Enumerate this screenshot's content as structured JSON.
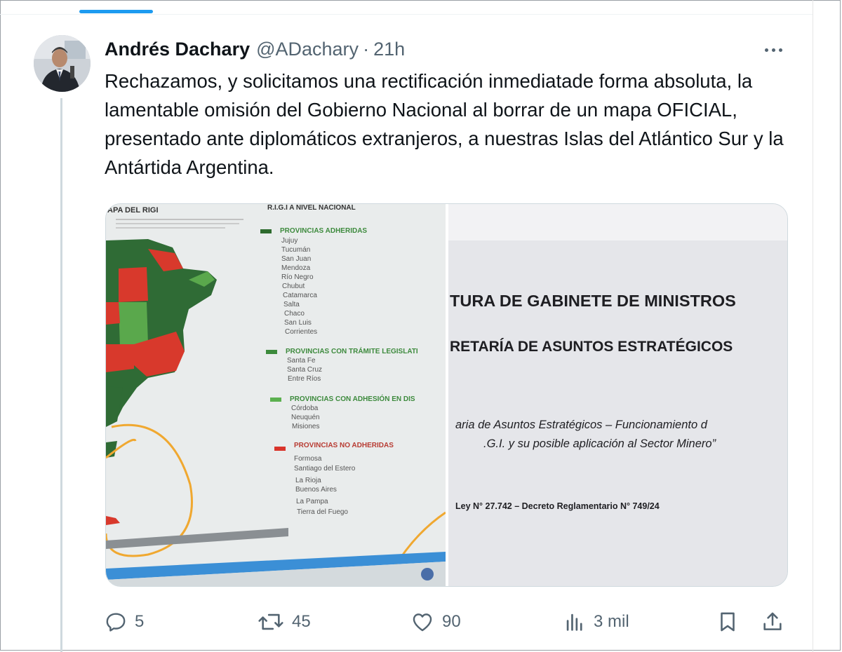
{
  "tweet": {
    "author_name": "Andrés Dachary",
    "author_handle": "@ADachary",
    "separator": "·",
    "time_ago": "21h",
    "text": "Rechazamos, y solicitamos una rectificación inmediatade forma absoluta, la lamentable omisión del Gobierno Nacional al borrar de un mapa OFICIAL, presentado ante diplomáticos extranjeros, a nuestras Islas del Atlántico Sur y la Antártida Argentina."
  },
  "media": {
    "left_photo": {
      "header_left": "APA DEL RIGI",
      "header_right": "R.I.G.I A NIVEL NACIONAL",
      "legend_groups": [
        {
          "title": "PROVINCIAS ADHERIDAS",
          "color": "#2e6b2e",
          "items": [
            "Jujuy",
            "Tucumán",
            "San Juan",
            "Mendoza",
            "Río Negro",
            "Chubut",
            "Catamarca",
            "Salta",
            "Chaco",
            "San Luis",
            "Corrientes"
          ]
        },
        {
          "title": "PROVINCIAS CON TRÁMITE LEGISLATI",
          "color": "#3c8a3c",
          "items": [
            "Santa Fe",
            "Santa Cruz",
            "Entre Ríos"
          ]
        },
        {
          "title": "PROVINCIAS CON ADHESIÓN EN DIS",
          "color": "#5bb04f",
          "items": [
            "Córdoba",
            "Neuquén",
            "Misiones"
          ]
        },
        {
          "title": "PROVINCIAS NO ADHERIDAS",
          "color": "#d9342b",
          "items": [
            "Formosa",
            "Santiago del Estero",
            "La Rioja",
            "Buenos Aires",
            "La Pampa",
            "Tierra del Fuego"
          ]
        }
      ]
    },
    "right_photo": {
      "line1": "TURA DE GABINETE DE MINISTROS",
      "line2": "RETARÍA DE ASUNTOS ESTRATÉGICOS",
      "line3": "aria de Asuntos Estratégicos – Funcionamiento d",
      "line4": ".G.I. y su posible aplicación al Sector Minero”",
      "line5": "Ley N° 27.742 – Decreto Reglamentario N° 749/24"
    }
  },
  "actions": {
    "replies": "5",
    "retweets": "45",
    "likes": "90",
    "views": "3 mil"
  },
  "colors": {
    "accent": "#1d9bf0",
    "secondary_text": "#536471",
    "primary_text": "#0f1419"
  }
}
